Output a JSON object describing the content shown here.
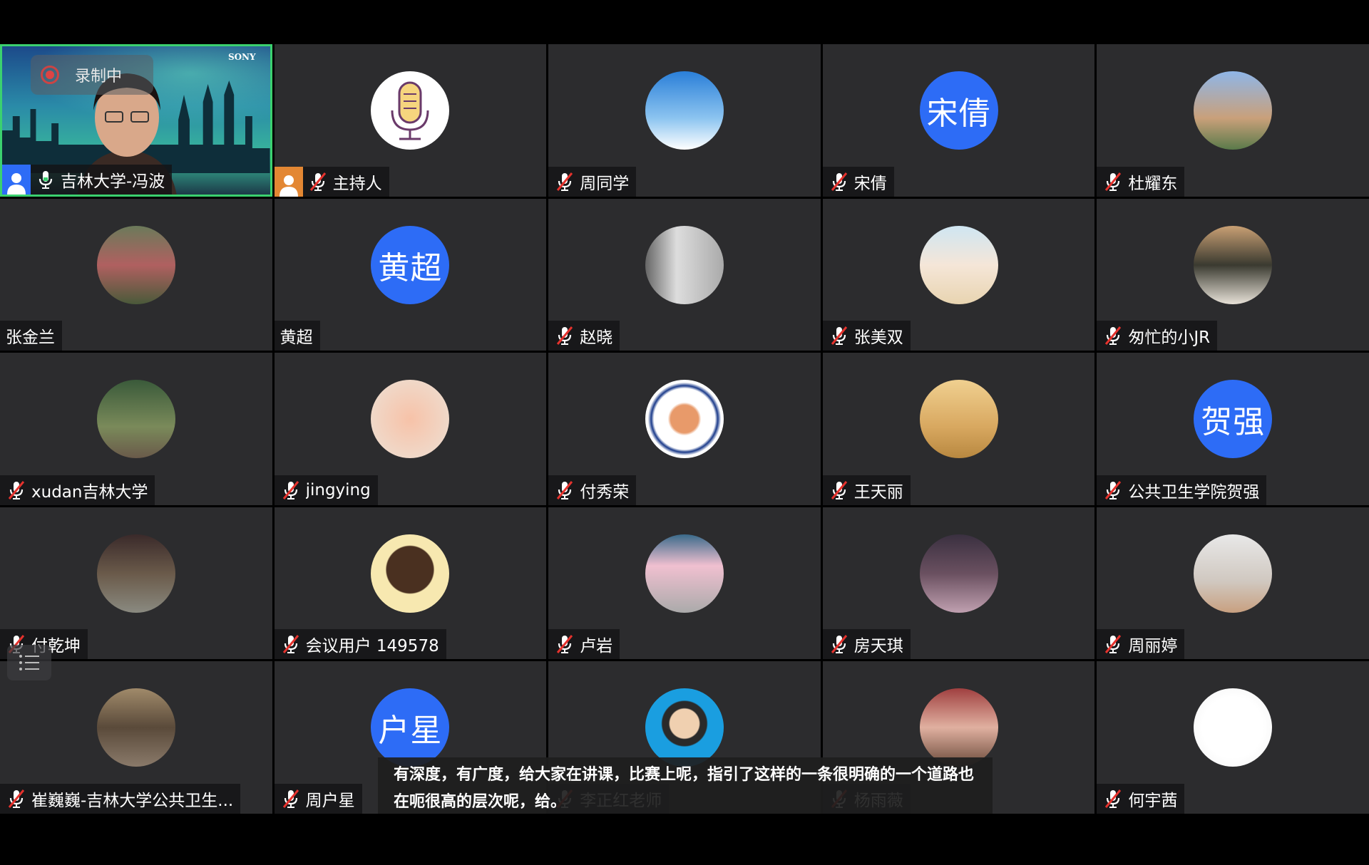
{
  "recording_label": "录制中",
  "camera_brand": "SONY",
  "caption_text": "有深度，有广度，给大家在讲课，比赛上呢，指引了这样的一条很明确的一个道路也在呃很高的层次呢，给。",
  "colors": {
    "tile_bg": "#2c2c2e",
    "active_border": "#3bd16f",
    "avatar_blue": "#2d6cf6",
    "host_badge": "#e38733"
  },
  "participants": [
    {
      "name": "吉林大学-冯波",
      "mic": "on",
      "video": true,
      "badge": "blue"
    },
    {
      "name": "主持人",
      "mic": "muted",
      "avatar": "mic-image",
      "badge": "orange"
    },
    {
      "name": "周同学",
      "mic": "muted",
      "avatar": "photo-sky"
    },
    {
      "name": "宋倩",
      "mic": "muted",
      "avatar_text": "宋倩"
    },
    {
      "name": "杜耀东",
      "mic": "muted",
      "avatar": "photo-jlu"
    },
    {
      "name": "张金兰",
      "mic": "none",
      "avatar": "photo-person"
    },
    {
      "name": "黄超",
      "mic": "none",
      "avatar_text": "黄超"
    },
    {
      "name": "赵晓",
      "mic": "muted",
      "avatar": "photo-child"
    },
    {
      "name": "张美双",
      "mic": "muted",
      "avatar": "photo-anime"
    },
    {
      "name": "匆忙的小JR",
      "mic": "muted",
      "avatar": "photo-dog"
    },
    {
      "name": "xudan吉林大学",
      "mic": "muted",
      "avatar": "photo-garden"
    },
    {
      "name": "jingying",
      "mic": "muted",
      "avatar": "photo-rose"
    },
    {
      "name": "付秀荣",
      "mic": "muted",
      "avatar": "photo-jlu-badge"
    },
    {
      "name": "王天丽",
      "mic": "muted",
      "avatar": "photo-field"
    },
    {
      "name": "公共卫生学院贺强",
      "mic": "muted",
      "avatar_text": "贺强"
    },
    {
      "name": "付乾坤",
      "mic": "muted",
      "avatar": "photo-man"
    },
    {
      "name": "会议用户 149578",
      "mic": "muted",
      "avatar": "photo-hair"
    },
    {
      "name": "卢岩",
      "mic": "muted",
      "avatar": "photo-hat"
    },
    {
      "name": "房天琪",
      "mic": "muted",
      "avatar": "photo-kid"
    },
    {
      "name": "周丽婷",
      "mic": "muted",
      "avatar": "photo-woman"
    },
    {
      "name": "崔巍巍-吉林大学公共卫生...",
      "mic": "muted",
      "avatar": "photo-street"
    },
    {
      "name": "周户星",
      "mic": "muted",
      "avatar_text": "户星"
    },
    {
      "name": "李正红老师",
      "mic": "muted",
      "avatar": "photo-cartoon"
    },
    {
      "name": "杨雨薇",
      "mic": "muted",
      "avatar": "photo-book"
    },
    {
      "name": "何宇茜",
      "mic": "muted",
      "avatar": "photo-goose"
    }
  ]
}
